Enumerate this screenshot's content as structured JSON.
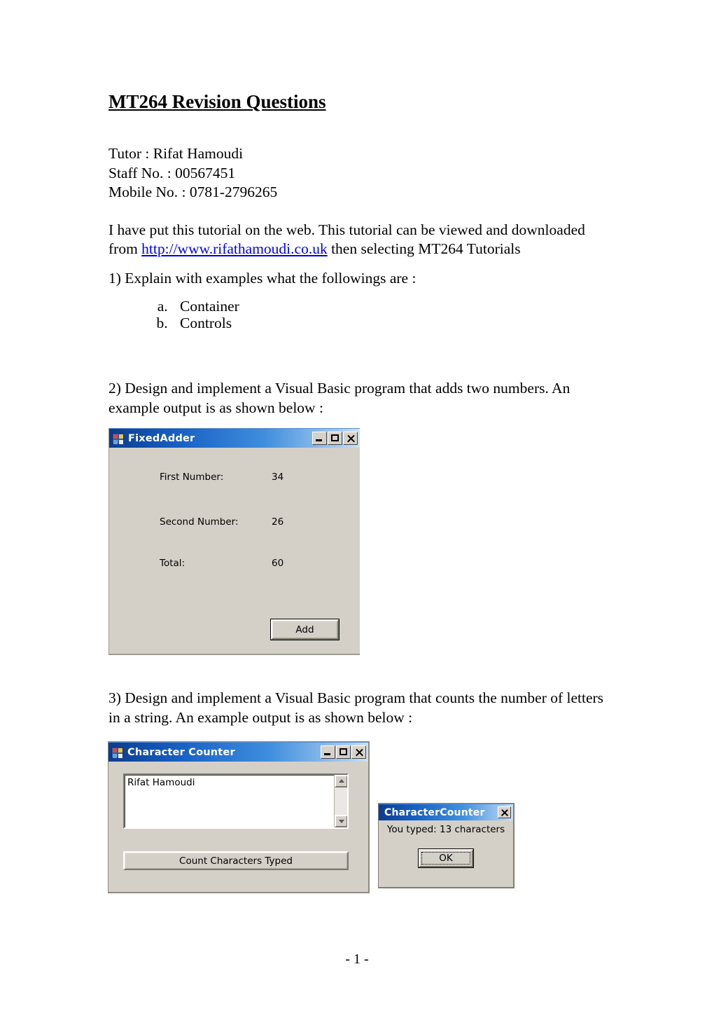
{
  "document": {
    "title": "MT264 Revision Questions",
    "meta": [
      "Tutor : Rifat Hamoudi",
      "Staff No. : 00567451",
      "Mobile No. : 0781-2796265"
    ],
    "intro": {
      "line1": "I have put this tutorial on the web. This tutorial can be viewed and downloaded from",
      "link_text": "http://www.rifathamoudi.co.uk",
      "line2_tail": " then selecting MT264 Tutorials"
    },
    "question1": {
      "text": "1) Explain with examples what the followings are :",
      "items": [
        "Container",
        "Controls"
      ]
    },
    "question2": {
      "text": "2) Design and implement a Visual Basic program that adds two numbers. An example output is as shown below :"
    },
    "question3": {
      "text": "3) Design and implement a Visual Basic program that counts the number of letters in a string. An example output is as shown below :"
    },
    "footer": "- 1 -"
  },
  "fixed_adder": {
    "title": "FixedAdder",
    "labels": {
      "first": "First Number:",
      "second": "Second Number:",
      "total": "Total:"
    },
    "values": {
      "first": "34",
      "second": "26",
      "total": "60"
    },
    "add_button": "Add"
  },
  "character_counter": {
    "title": "Character Counter",
    "input_value": "Rifat Hamoudi",
    "count_button": "Count Characters Typed"
  },
  "message_box": {
    "title": "CharacterCounter",
    "message": "You typed:  13 characters",
    "ok_button": "OK"
  },
  "colors": {
    "link": "#0000ee",
    "title_bar_start": "#0b3c8e",
    "title_bar_end": "#cfe2f5",
    "window_face": "#d4d0c8"
  }
}
